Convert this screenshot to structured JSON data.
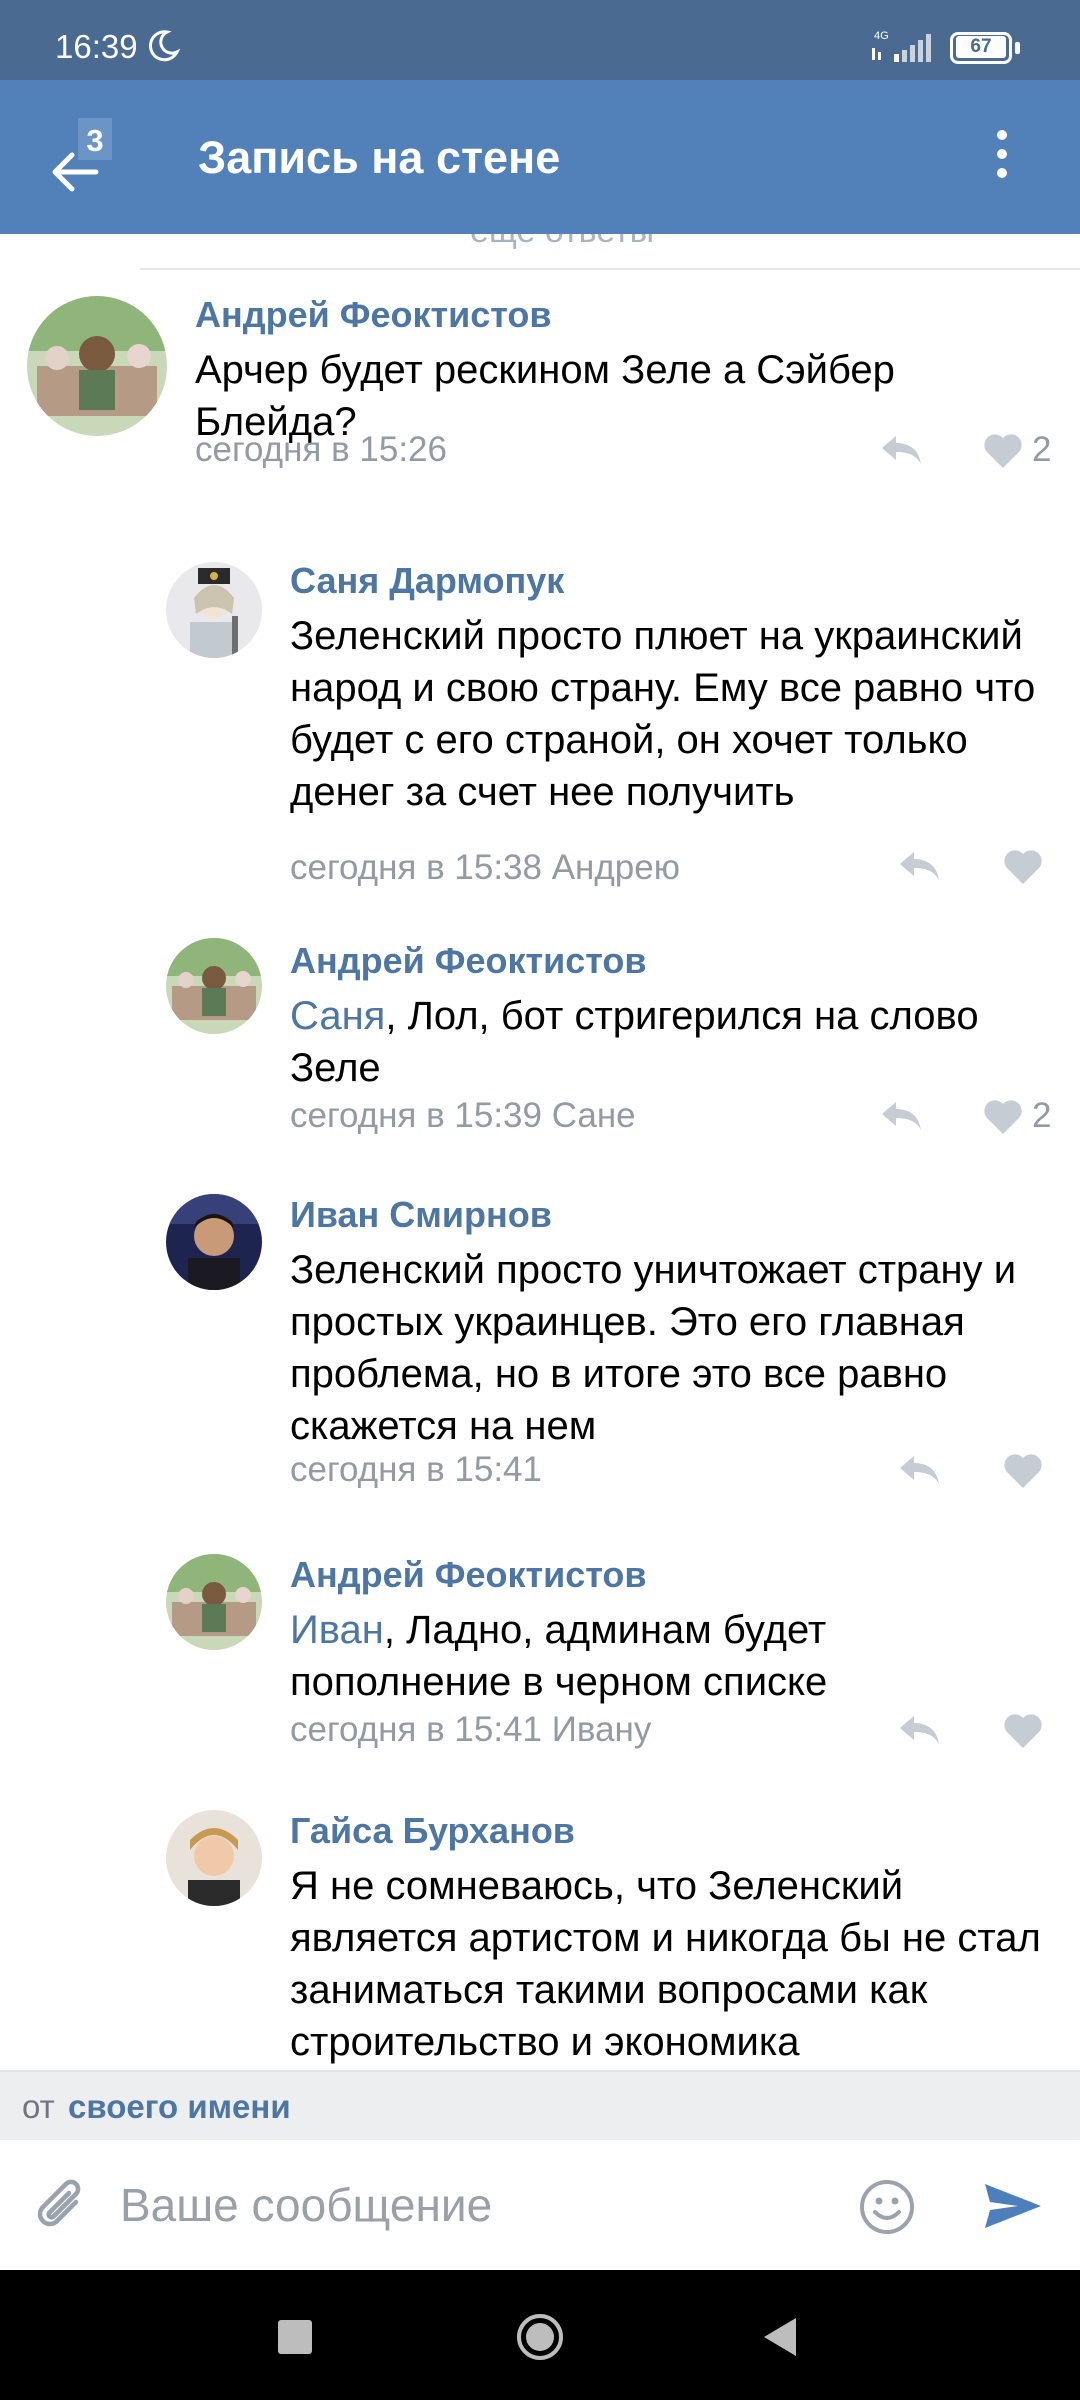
{
  "status_bar": {
    "time": "16:39",
    "network": "4G",
    "battery": "67",
    "icons": [
      "moon-icon",
      "signal-icon",
      "battery-icon"
    ]
  },
  "app_bar": {
    "title": "Запись на стене",
    "badge": "3",
    "icons": [
      "back-arrow-icon",
      "menu-icon"
    ]
  },
  "more_replies": {
    "label": "еще ответы"
  },
  "comments": [
    {
      "author": "Андрей Феоктистов",
      "text": "Арчер будет рескином Зеле а Сэйбер Блейда?",
      "mention": "",
      "meta": "сегодня в 15:26",
      "likes": "2"
    },
    {
      "author": "Саня Дармопук",
      "text": "Зеленский просто плюет на украинский народ и свою страну. Ему все равно что будет с его страной, он хочет только денег за счет нее получить",
      "mention": "",
      "meta": "сегодня в 15:38 Андрею",
      "likes": ""
    },
    {
      "author": "Андрей Феоктистов",
      "text": ", Лол, бот стригерился на слово Зеле",
      "mention": "Саня",
      "meta": "сегодня в 15:39 Сане",
      "likes": "2"
    },
    {
      "author": "Иван Смирнов",
      "text": "Зеленский просто уничтожает страну и простых украинцев. Это его главная проблема, но в итоге это все равно скажется на нем",
      "mention": "",
      "meta": "сегодня в 15:41",
      "likes": ""
    },
    {
      "author": "Андрей Феоктистов",
      "text": ", Ладно, админам будет пополнение в черном списке",
      "mention": "Иван",
      "meta": "сегодня в 15:41 Ивану",
      "likes": ""
    },
    {
      "author": "Гайса Бурханов",
      "text": "Я не сомневаюсь, что Зеленский является артистом и никогда бы не стал заниматься такими вопросами как строительство и экономика",
      "mention": "",
      "meta": "",
      "likes": ""
    }
  ],
  "sender": {
    "prefix": "от",
    "name": "своего имени"
  },
  "composer": {
    "placeholder": "Ваше сообщение",
    "icons": [
      "attach-icon",
      "emoji-icon",
      "send-icon"
    ]
  },
  "colors": {
    "status_bar": "#4a6a92",
    "app_bar": "#5181b8",
    "link": "#4d76a3",
    "meta": "#939aa4"
  }
}
